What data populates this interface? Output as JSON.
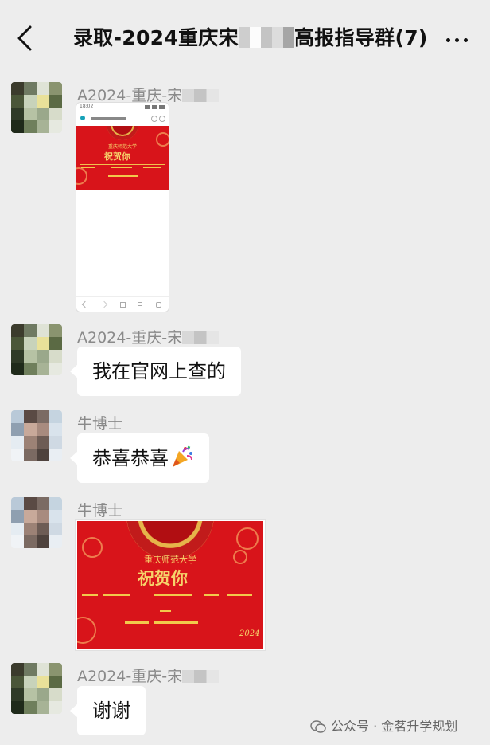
{
  "header": {
    "title_prefix": "录取-2024重庆宋",
    "title_suffix": "高报指导群(7)"
  },
  "messages": [
    {
      "sender_visible": "A2024-重庆-宋",
      "type": "image",
      "image": {
        "kind": "phone-screenshot",
        "status_time": "18:02",
        "card_title": "重庆师范大学",
        "card_heading": "祝贺你"
      }
    },
    {
      "sender_visible": "A2024-重庆-宋",
      "type": "text",
      "text": "我在官网上查的"
    },
    {
      "sender_visible": "牛博士",
      "type": "text",
      "text": "恭喜恭喜",
      "emoji": "party-popper"
    },
    {
      "sender_visible": "牛博士",
      "type": "image",
      "image": {
        "kind": "congratulation-card",
        "card_title": "重庆师范大学",
        "card_heading": "祝贺你",
        "card_year": "2024"
      }
    },
    {
      "sender_visible": "A2024-重庆-宋",
      "type": "text",
      "text": "谢谢"
    }
  ],
  "watermark": {
    "text": "公众号 · 金茗升学规划",
    "icon": "wechat-official-account-icon"
  },
  "colors": {
    "background": "#ededed",
    "bubble": "#ffffff",
    "card_red": "#d8141a",
    "gold": "#f0c24d"
  }
}
